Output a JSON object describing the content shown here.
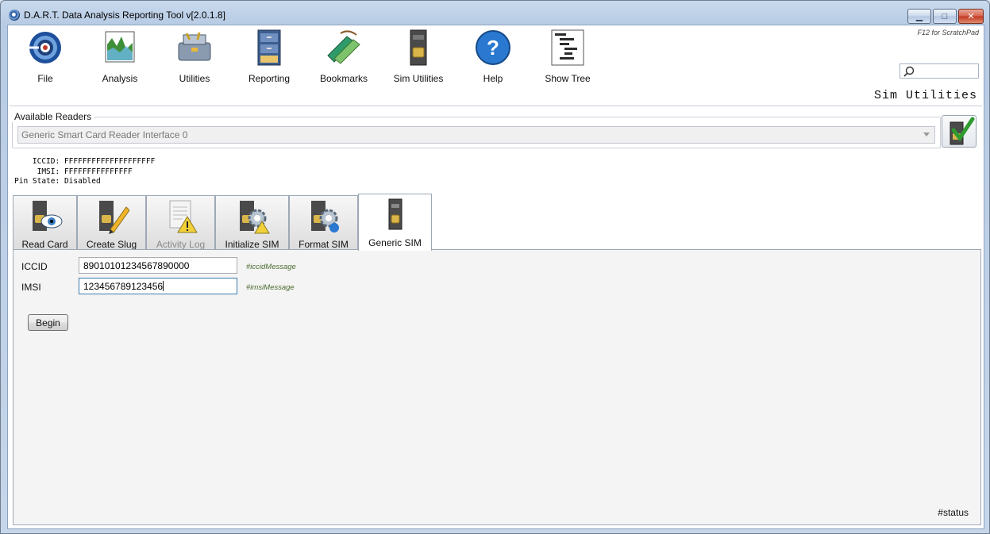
{
  "window": {
    "title": "D.A.R.T. Data Analysis Reporting Tool v[2.0.1.8]",
    "minimize": "▁",
    "maximize": "□",
    "close": "✕"
  },
  "toolbar": {
    "items": [
      {
        "label": "File",
        "icon": "file-target-icon"
      },
      {
        "label": "Analysis",
        "icon": "analysis-chart-icon"
      },
      {
        "label": "Utilities",
        "icon": "toolbox-icon"
      },
      {
        "label": "Reporting",
        "icon": "file-cabinet-icon"
      },
      {
        "label": "Bookmarks",
        "icon": "bookmarks-icon"
      },
      {
        "label": "Sim Utilities",
        "icon": "sim-card-icon"
      },
      {
        "label": "Help",
        "icon": "help-icon"
      },
      {
        "label": "Show Tree",
        "icon": "tree-icon"
      }
    ],
    "scratchpad_hint": "F12 for ScratchPad",
    "search_placeholder": ""
  },
  "section_title": "Sim Utilities",
  "readers": {
    "legend": "Available Readers",
    "selected": "Generic Smart Card Reader Interface 0"
  },
  "card_info": {
    "iccid_label": "ICCID:",
    "iccid": "FFFFFFFFFFFFFFFFFFFF",
    "imsi_label": "IMSI:",
    "imsi": "FFFFFFFFFFFFFFF",
    "pin_label": "Pin State:",
    "pin": "Disabled"
  },
  "tabs": [
    {
      "label": "Read Card",
      "icon": "sim-eye-icon",
      "state": "normal"
    },
    {
      "label": "Create Slug",
      "icon": "sim-pencil-icon",
      "state": "normal"
    },
    {
      "label": "Activity Log",
      "icon": "log-warning-icon",
      "state": "disabled"
    },
    {
      "label": "Initialize SIM",
      "icon": "sim-gear-warning-icon",
      "state": "normal"
    },
    {
      "label": "Format SIM",
      "icon": "sim-gear-icon",
      "state": "normal"
    },
    {
      "label": "Generic SIM",
      "icon": "sim-card-icon",
      "state": "active"
    }
  ],
  "form": {
    "iccid_label": "ICCID",
    "iccid_value": "89010101234567890000",
    "iccid_message": "#iccidMessage",
    "imsi_label": "IMSI",
    "imsi_value": "123456789123456",
    "imsi_message": "#imsiMessage",
    "begin_label": "Begin"
  },
  "status": "#status"
}
